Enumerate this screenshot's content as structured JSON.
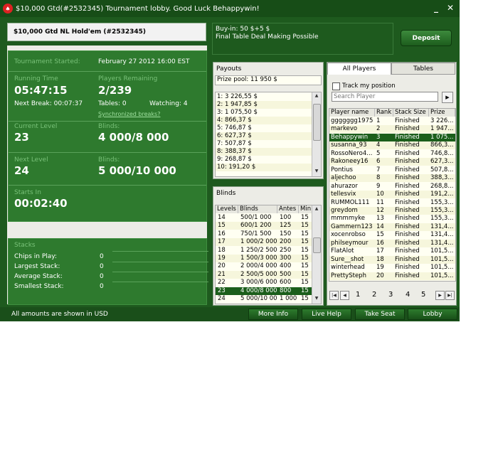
{
  "window": {
    "title": "$10,000 Gtd(#2532345) Tournament lobby. Good Luck Behappywin!",
    "minimize_glyph": "_",
    "close_glyph": "✕"
  },
  "header": {
    "tournament_name": "$10,000 Gtd NL Hold'em (#2532345)",
    "buyin": "Buy-in: 50 $+5 $",
    "final_table": "Final Table Deal Making Possible",
    "deposit_label": "Deposit"
  },
  "info": {
    "started_label": "Tournament Started:",
    "started_value": "February 27 2012  16:00 EST",
    "running_label": "Running Time",
    "running_value": "05:47:15",
    "players_label": "Players Remaining",
    "players_value": "2/239",
    "next_break": "Next Break: 00:07:37",
    "tables": "Tables: 0",
    "watching": "Watching: 4",
    "sync_link": "Synchronized breaks?",
    "current_level_label": "Current Level",
    "current_level_value": "23",
    "current_blinds_label": "Blinds:",
    "current_blinds_value": "4 000/8 000",
    "next_level_label": "Next Level",
    "next_level_value": "24",
    "next_blinds_label": "Blinds:",
    "next_blinds_value": "5 000/10 000",
    "starts_in_label": "Starts In",
    "starts_in_value": "00:02:40"
  },
  "stacks": {
    "title": "Stacks",
    "rows": [
      {
        "label": "Chips in Play:",
        "value": "0"
      },
      {
        "label": "Largest Stack:",
        "value": "0"
      },
      {
        "label": "Average Stack:",
        "value": "0"
      },
      {
        "label": "Smallest Stack:",
        "value": "0"
      }
    ]
  },
  "payouts": {
    "title": "Payouts",
    "prize_pool": "Prize pool: 11 950 $",
    "items": [
      "1: 3 226,55 $",
      "2: 1 947,85 $",
      "3: 1 075,50 $",
      "4: 866,37 $",
      "5: 746,87 $",
      "6: 627,37 $",
      "7: 507,87 $",
      "8: 388,37 $",
      "9: 268,87 $",
      "10: 191,20 $"
    ]
  },
  "blinds": {
    "title": "Blinds",
    "headers": [
      "Levels",
      "Blinds",
      "Antes",
      "Min."
    ],
    "rows": [
      [
        "14",
        "500/1 000",
        "100",
        "15"
      ],
      [
        "15",
        "600/1 200",
        "125",
        "15"
      ],
      [
        "16",
        "750/1 500",
        "150",
        "15"
      ],
      [
        "17",
        "1 000/2 000",
        "200",
        "15"
      ],
      [
        "18",
        "1 250/2 500",
        "250",
        "15"
      ],
      [
        "19",
        "1 500/3 000",
        "300",
        "15"
      ],
      [
        "20",
        "2 000/4 000",
        "400",
        "15"
      ],
      [
        "21",
        "2 500/5 000",
        "500",
        "15"
      ],
      [
        "22",
        "3 000/6 000",
        "600",
        "15"
      ],
      [
        "23",
        "4 000/8 000",
        "800",
        "15"
      ],
      [
        "24",
        "5 000/10 000 ...",
        "1 000",
        "15"
      ]
    ]
  },
  "players": {
    "tab_players": "All Players",
    "tab_tables": "Tables",
    "track_label": "Track my position",
    "search_placeholder": "Search Player",
    "headers": [
      "Player name",
      "Rank",
      "Stack Size",
      "Prize"
    ],
    "rows": [
      [
        "ggggggg1975",
        "1",
        "Finished",
        "3 226..."
      ],
      [
        "markevo",
        "2",
        "Finished",
        "1 947..."
      ],
      [
        "Behappywin",
        "3",
        "Finished",
        "1 075..."
      ],
      [
        "susanna_93",
        "4",
        "Finished",
        "866,3..."
      ],
      [
        "RossoNero4...",
        "5",
        "Finished",
        "746,8..."
      ],
      [
        "Rakoneey16",
        "6",
        "Finished",
        "627,3..."
      ],
      [
        "Pontius",
        "7",
        "Finished",
        "507,8..."
      ],
      [
        "aljechoo",
        "8",
        "Finished",
        "388,3..."
      ],
      [
        "ahurazor",
        "9",
        "Finished",
        "268,8..."
      ],
      [
        "tellesvix",
        "10",
        "Finished",
        "191,2..."
      ],
      [
        "RUMMOL111",
        "11",
        "Finished",
        "155,3..."
      ],
      [
        "greydom",
        "12",
        "Finished",
        "155,3..."
      ],
      [
        "mmmmyke",
        "13",
        "Finished",
        "155,3..."
      ],
      [
        "Gammern123",
        "14",
        "Finished",
        "131,4..."
      ],
      [
        "xocenrobso",
        "15",
        "Finished",
        "131,4..."
      ],
      [
        "philseymour",
        "16",
        "Finished",
        "131,4..."
      ],
      [
        "FlatAlot",
        "17",
        "Finished",
        "101,5..."
      ],
      [
        "Sure__shot",
        "18",
        "Finished",
        "101,5..."
      ],
      [
        "winterhead",
        "19",
        "Finished",
        "101,5..."
      ],
      [
        "PrettySteph",
        "20",
        "Finished",
        "101,5..."
      ]
    ],
    "pages": [
      "1",
      "2",
      "3",
      "4",
      "5"
    ]
  },
  "footer": {
    "note": "All amounts are shown in USD",
    "more_info": "More Info",
    "live_help": "Live Help",
    "take_seat": "Take Seat",
    "lobby": "Lobby"
  }
}
